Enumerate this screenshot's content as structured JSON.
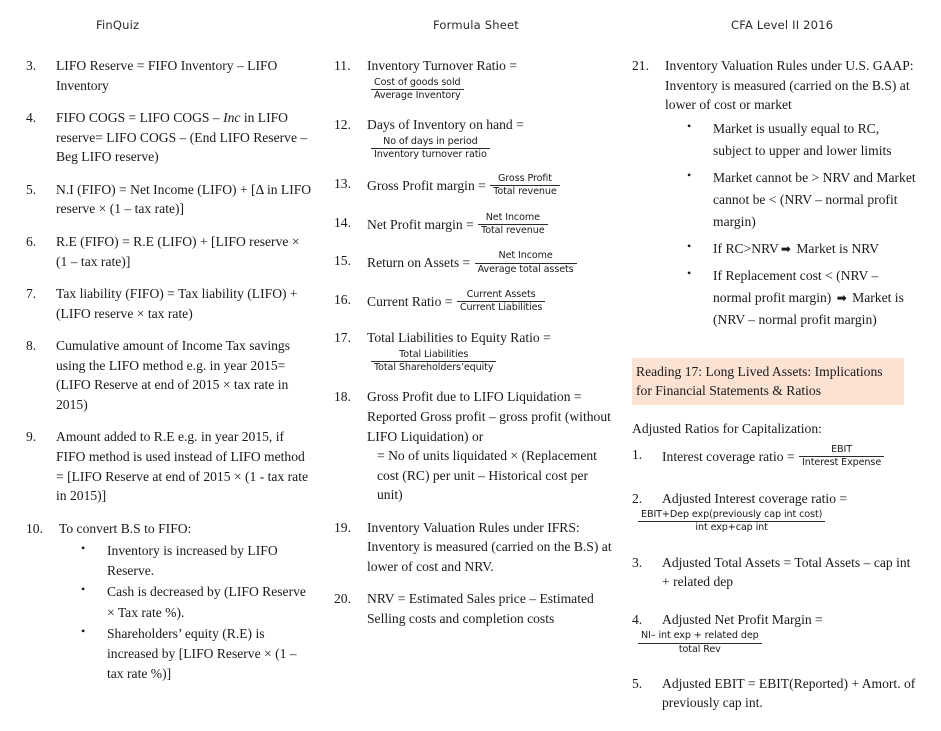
{
  "header": {
    "left": "FinQuiz",
    "center": "Formula Sheet",
    "right": "CFA Level II 2016"
  },
  "highlight_color": "#fbe2d2",
  "columns": {
    "column1": {
      "items": [
        {
          "num": "3.",
          "text": "LIFO Reserve = FIFO Inventory – LIFO Inventory"
        },
        {
          "num": "4.",
          "text_before_italic": "FIFO COGS = LIFO COGS – ",
          "italic": "Inc",
          "text_after_italic": " in LIFO reserve= LIFO COGS – (End LIFO Reserve – Beg LIFO reserve)"
        },
        {
          "num": "5.",
          "text": "N.I (FIFO) = Net Income (LIFO) + [Δ in LIFO reserve × (1 – tax rate)]"
        },
        {
          "num": "6.",
          "text": "R.E (FIFO) = R.E (LIFO) + [LIFO reserve × (1 – tax rate)]"
        },
        {
          "num": "7.",
          "text": "Tax liability (FIFO) = Tax liability (LIFO) + (LIFO reserve × tax rate)"
        },
        {
          "num": "8.",
          "text": "Cumulative amount of Income Tax savings using the LIFO method e.g. in year 2015= (LIFO Reserve at end of 2015 × tax rate in 2015)"
        },
        {
          "num": "9.",
          "text": "Amount added to R.E e.g. in year 2015, if FIFO method is used instead of LIFO method =  [LIFO Reserve at end of 2015 × (1 - tax rate in 2015)]"
        },
        {
          "num": "10.",
          "text": "To convert B.S to FIFO:",
          "bullets": [
            "Inventory is increased by LIFO Reserve.",
            "Cash is decreased by (LIFO Reserve × Tax rate %).",
            "Shareholders’ equity (R.E) is increased by [LIFO Reserve × (1 – tax rate %)]"
          ]
        }
      ]
    },
    "column2": {
      "items": [
        {
          "num": "11.",
          "text": "Inventory Turnover Ratio  =",
          "fraction": {
            "numerator": "Cost of goods sold",
            "denominator": "Average Inventory"
          },
          "fraction_style": "block"
        },
        {
          "num": "12.",
          "text": "Days of Inventory on hand =",
          "fraction": {
            "numerator": "No of days in period",
            "denominator": "Inventory turnover ratio"
          },
          "fraction_style": "block"
        },
        {
          "num": "13.",
          "text": "Gross Profit margin = ",
          "fraction": {
            "numerator": "Gross Profit",
            "denominator": "Total revenue"
          },
          "fraction_style": "inline"
        },
        {
          "num": "14.",
          "text": "Net Profit margin = ",
          "fraction": {
            "numerator": "Net Income",
            "denominator": "Total revenue"
          },
          "fraction_style": "inline"
        },
        {
          "num": "15.",
          "text": "Return on Assets = ",
          "fraction": {
            "numerator": "Net Income",
            "denominator": "Average total assets"
          },
          "fraction_style": "inline"
        },
        {
          "num": "16.",
          "text": "Current Ratio = ",
          "fraction": {
            "numerator": "Current Assets",
            "denominator": "Current Liabilities"
          },
          "fraction_style": "inline"
        },
        {
          "num": "17.",
          "text": "Total Liabilities to Equity Ratio =",
          "fraction": {
            "numerator": "Total Liabilities",
            "denominator": "Total Shareholders’equity"
          },
          "fraction_style": "block"
        },
        {
          "num": "18.",
          "text": "Gross Profit due to LIFO Liquidation = Reported Gross profit – gross profit (without LIFO Liquidation) or",
          "continuation": "= No of units liquidated × (Replacement cost (RC) per unit – Historical cost per unit)"
        },
        {
          "num": "19.",
          "text": "Inventory Valuation Rules under IFRS: Inventory is measured (carried on the B.S) at lower of cost and NRV."
        },
        {
          "num": "20.",
          "text": "NRV = Estimated Sales price – Estimated Selling costs and completion costs"
        }
      ]
    },
    "column3": {
      "items": [
        {
          "num": "21.",
          "text": "Inventory Valuation Rules under U.S. GAAP: Inventory is measured (carried on the B.S) at lower of cost or market",
          "bullets": [
            {
              "text": "Market is usually equal to RC, subject to upper and lower limits"
            },
            {
              "text": "Market cannot be > NRV and Market cannot be < (NRV – normal profit margin)"
            },
            {
              "before_arrow": "If RC>NRV",
              "arrow": "➡",
              "after_arrow": " Market is NRV"
            },
            {
              "before_arrow": "If Replacement cost < (NRV – normal profit margin) ",
              "arrow": "➡",
              "after_arrow": " Market is (NRV – normal profit margin)"
            }
          ]
        }
      ],
      "reading_box": "Reading 17: Long Lived Assets: Implications for Financial Statements & Ratios",
      "section_lead": "Adjusted Ratios for Capitalization:",
      "adjusted_items": [
        {
          "num": "1.",
          "text": "Interest coverage ratio = ",
          "fraction": {
            "numerator": "EBIT",
            "denominator": "Interest Expense"
          },
          "fraction_style": "inline"
        },
        {
          "num": "2.",
          "text": "Adjusted Interest coverage ratio  =",
          "fraction": {
            "numerator": "EBIT+Dep exp(previously cap int cost)",
            "denominator": "int exp+cap int"
          },
          "fraction_style": "block"
        },
        {
          "num": "3.",
          "text": "Adjusted Total Assets = Total Assets – cap int + related dep"
        },
        {
          "num": "4.",
          "text": "Adjusted Net Profit Margin =",
          "fraction": {
            "numerator": "NI– int exp + related dep",
            "denominator": "total Rev"
          },
          "fraction_style": "block"
        },
        {
          "num": "5.",
          "text": "Adjusted EBIT = EBIT(Reported) + Amort. of previously cap int."
        }
      ]
    }
  }
}
